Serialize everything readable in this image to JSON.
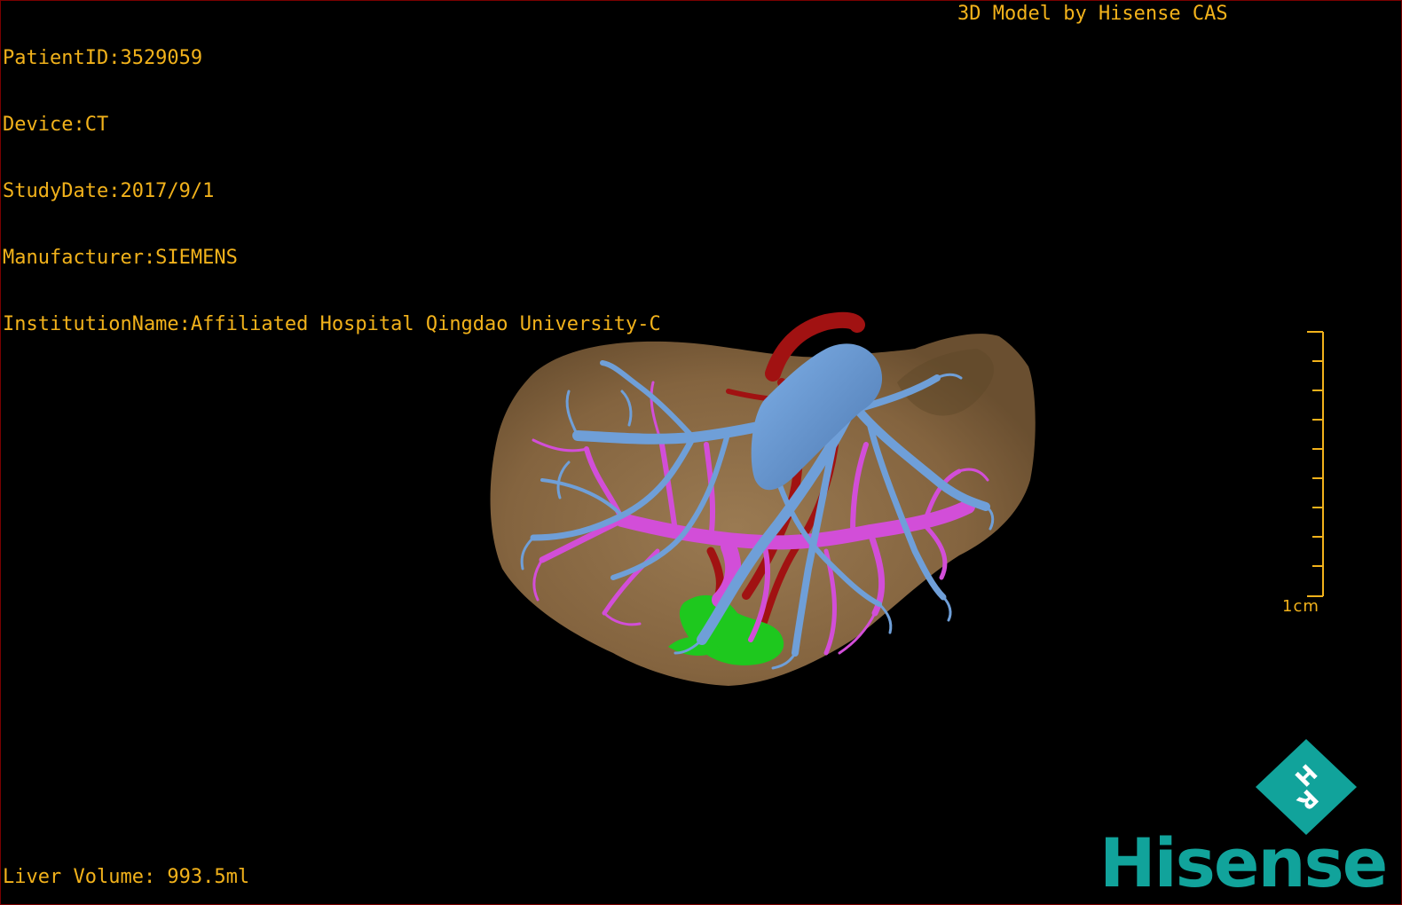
{
  "patient_info": {
    "patient_id": "PatientID:3529059",
    "device": "Device:CT",
    "study_date": "StudyDate:2017/9/1",
    "manufacturer": "Manufacturer:SIEMENS",
    "institution": "InstitutionName:Affiliated Hospital Qingdao University-C"
  },
  "credit": "3D Model by Hisense CAS",
  "liver_volume": "Liver Volume: 993.5ml",
  "scale_bar": {
    "label": "1cm"
  },
  "orientation_cube": {
    "letters": [
      "H",
      "R"
    ]
  },
  "brand": {
    "logo_text": "Hisense",
    "color": "#11a39b"
  },
  "colors": {
    "text": "#f2b21b",
    "liver": "#8c6c46",
    "hepatic_vein": "#6f9fd8",
    "portal_vein": "#d24ed8",
    "artery": "#a11212",
    "gallbladder": "#1ec81e"
  }
}
